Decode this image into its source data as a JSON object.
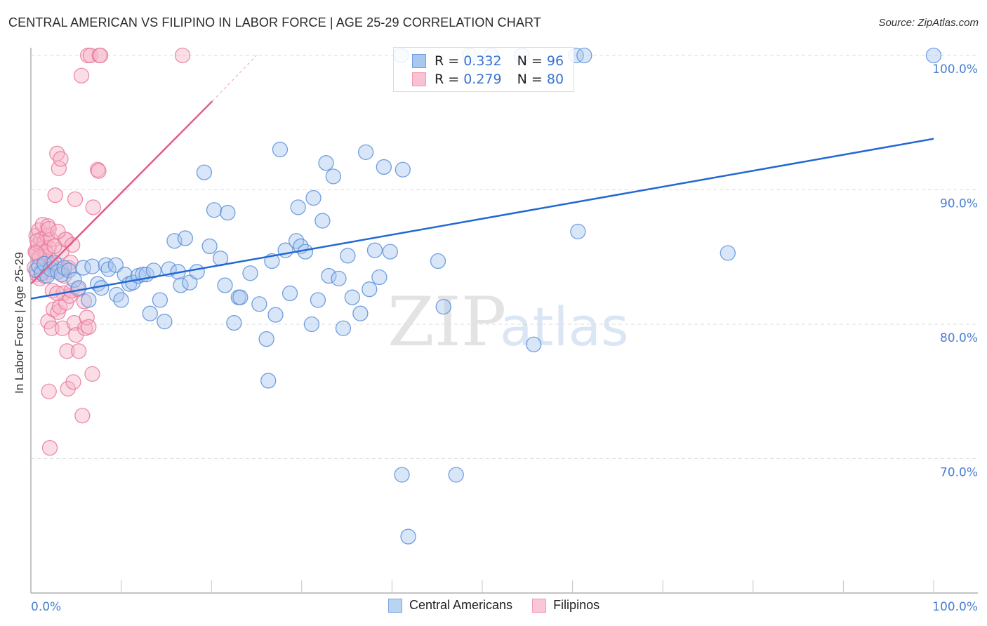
{
  "header": {
    "title": "CENTRAL AMERICAN VS FILIPINO IN LABOR FORCE | AGE 25-29 CORRELATION CHART",
    "source": "Source: ZipAtlas.com"
  },
  "watermark": {
    "zip": "ZIP",
    "atlas": "atlas"
  },
  "legend": {
    "rows": [
      {
        "r_label": "R =",
        "r_value": "0.332",
        "n_label": "N =",
        "n_value": "96"
      },
      {
        "r_label": "R =",
        "r_value": "0.279",
        "n_label": "N =",
        "n_value": "80"
      }
    ]
  },
  "colors": {
    "blue_fill": "#a9c8f0",
    "blue_stroke": "#5b8fd9",
    "blue_line": "#2268d3",
    "pink_fill": "#f7b3c8",
    "pink_stroke": "#e87a9c",
    "pink_line": "#e35d88",
    "tick_text": "#4a7fd1",
    "grid": "#dddddd"
  },
  "chart_data": {
    "type": "scatter",
    "title": "CENTRAL AMERICAN VS FILIPINO IN LABOR FORCE | AGE 25-29 CORRELATION CHART",
    "xlabel": "",
    "ylabel": "In Labor Force | Age 25-29",
    "xlim": [
      0,
      100
    ],
    "ylim": [
      62.5,
      101.2
    ],
    "x_tick_labels": [
      "0.0%",
      "100.0%"
    ],
    "y_ticks": [
      70,
      80,
      90,
      100
    ],
    "y_tick_labels": [
      "70.0%",
      "80.0%",
      "90.0%",
      "100.0%"
    ],
    "grid": "horizontal-dashed",
    "legend_position": "top-center",
    "series": [
      {
        "name": "Central Americans",
        "r": 0.332,
        "n": 96,
        "trend": {
          "x": [
            0,
            100
          ],
          "y": [
            81.9,
            93.8
          ]
        },
        "points": [
          [
            0.6,
            84.0
          ],
          [
            0.9,
            84.3
          ],
          [
            1.2,
            83.8
          ],
          [
            1.5,
            84.5
          ],
          [
            1.8,
            83.6
          ],
          [
            2.2,
            84.1
          ],
          [
            2.6,
            84.6
          ],
          [
            3.0,
            83.9
          ],
          [
            3.4,
            83.7
          ],
          [
            3.7,
            84.2
          ],
          [
            4.2,
            84.0
          ],
          [
            4.8,
            83.3
          ],
          [
            5.3,
            82.7
          ],
          [
            5.8,
            84.2
          ],
          [
            6.4,
            81.8
          ],
          [
            6.8,
            84.3
          ],
          [
            7.4,
            83.0
          ],
          [
            7.8,
            82.7
          ],
          [
            8.3,
            84.4
          ],
          [
            8.6,
            84.1
          ],
          [
            9.4,
            84.4
          ],
          [
            9.5,
            82.2
          ],
          [
            10.0,
            81.8
          ],
          [
            10.4,
            83.7
          ],
          [
            10.9,
            83.0
          ],
          [
            11.3,
            83.1
          ],
          [
            11.9,
            83.6
          ],
          [
            12.4,
            83.7
          ],
          [
            12.8,
            83.7
          ],
          [
            13.2,
            80.8
          ],
          [
            13.6,
            84.0
          ],
          [
            14.3,
            81.8
          ],
          [
            14.8,
            80.2
          ],
          [
            15.3,
            84.1
          ],
          [
            15.9,
            86.2
          ],
          [
            16.3,
            83.9
          ],
          [
            16.6,
            82.9
          ],
          [
            17.1,
            86.4
          ],
          [
            17.6,
            83.1
          ],
          [
            18.4,
            83.9
          ],
          [
            19.2,
            91.3
          ],
          [
            19.8,
            85.8
          ],
          [
            20.3,
            88.5
          ],
          [
            21.0,
            84.9
          ],
          [
            21.5,
            82.9
          ],
          [
            21.8,
            88.3
          ],
          [
            22.5,
            80.1
          ],
          [
            23.0,
            82.0
          ],
          [
            23.2,
            82.0
          ],
          [
            24.3,
            83.8
          ],
          [
            25.3,
            81.5
          ],
          [
            26.1,
            78.9
          ],
          [
            26.3,
            75.8
          ],
          [
            26.7,
            84.7
          ],
          [
            27.1,
            80.7
          ],
          [
            27.6,
            93.0
          ],
          [
            28.2,
            85.5
          ],
          [
            28.7,
            82.3
          ],
          [
            29.4,
            86.2
          ],
          [
            29.6,
            88.7
          ],
          [
            29.9,
            85.8
          ],
          [
            30.4,
            85.4
          ],
          [
            31.1,
            80.0
          ],
          [
            31.3,
            89.4
          ],
          [
            31.8,
            81.8
          ],
          [
            32.3,
            87.7
          ],
          [
            32.7,
            92.0
          ],
          [
            33.0,
            83.6
          ],
          [
            33.5,
            91.0
          ],
          [
            34.1,
            83.4
          ],
          [
            34.6,
            79.7
          ],
          [
            35.1,
            85.1
          ],
          [
            35.6,
            82.0
          ],
          [
            36.5,
            80.8
          ],
          [
            37.1,
            92.8
          ],
          [
            37.5,
            82.6
          ],
          [
            38.1,
            85.5
          ],
          [
            38.6,
            83.5
          ],
          [
            39.1,
            91.7
          ],
          [
            39.8,
            85.4
          ],
          [
            41.0,
            100.0
          ],
          [
            41.1,
            68.8
          ],
          [
            41.2,
            91.5
          ],
          [
            41.8,
            64.2
          ],
          [
            45.1,
            84.7
          ],
          [
            45.7,
            81.3
          ],
          [
            47.1,
            68.8
          ],
          [
            48.6,
            100.0
          ],
          [
            51.0,
            100.0
          ],
          [
            54.4,
            100.0
          ],
          [
            55.7,
            78.5
          ],
          [
            60.4,
            100.0
          ],
          [
            60.6,
            86.9
          ],
          [
            61.3,
            100.0
          ],
          [
            77.2,
            85.3
          ],
          [
            100.0,
            100.0
          ]
        ]
      },
      {
        "name": "Filipinos",
        "r": 0.279,
        "n": 80,
        "trend": {
          "x": [
            0,
            20.1
          ],
          "y": [
            83.0,
            96.6
          ],
          "extended": {
            "x": [
              20.1,
              25.0
            ],
            "y": [
              96.6,
              100.0
            ]
          }
        },
        "points": [
          [
            0.4,
            84.2
          ],
          [
            0.5,
            85.4
          ],
          [
            0.6,
            86.6
          ],
          [
            0.7,
            83.7
          ],
          [
            0.8,
            85.9
          ],
          [
            0.9,
            87.0
          ],
          [
            1.0,
            84.9
          ],
          [
            1.1,
            86.3
          ],
          [
            1.2,
            85.6
          ],
          [
            1.3,
            87.4
          ],
          [
            1.4,
            84.4
          ],
          [
            1.5,
            86.1
          ],
          [
            1.6,
            85.0
          ],
          [
            1.7,
            84.7
          ],
          [
            1.8,
            86.6
          ],
          [
            1.9,
            87.3
          ],
          [
            2.0,
            85.7
          ],
          [
            2.1,
            83.9
          ],
          [
            2.2,
            86.3
          ],
          [
            2.3,
            84.5
          ],
          [
            1.9,
            80.2
          ],
          [
            2.0,
            75.0
          ],
          [
            2.1,
            70.8
          ],
          [
            2.2,
            84.4
          ],
          [
            2.3,
            79.7
          ],
          [
            2.4,
            82.5
          ],
          [
            2.5,
            81.1
          ],
          [
            2.7,
            89.6
          ],
          [
            2.9,
            92.7
          ],
          [
            3.0,
            80.9
          ],
          [
            3.1,
            91.6
          ],
          [
            3.2,
            81.3
          ],
          [
            3.3,
            92.3
          ],
          [
            3.4,
            85.4
          ],
          [
            3.5,
            79.7
          ],
          [
            3.6,
            82.3
          ],
          [
            3.7,
            83.6
          ],
          [
            3.8,
            86.3
          ],
          [
            3.9,
            86.3
          ],
          [
            3.9,
            81.6
          ],
          [
            4.0,
            78.0
          ],
          [
            4.1,
            75.2
          ],
          [
            4.2,
            84.2
          ],
          [
            4.3,
            82.1
          ],
          [
            4.4,
            84.6
          ],
          [
            4.5,
            82.5
          ],
          [
            4.6,
            85.9
          ],
          [
            4.7,
            75.7
          ],
          [
            4.8,
            80.1
          ],
          [
            4.9,
            89.3
          ],
          [
            5.0,
            79.2
          ],
          [
            5.2,
            82.6
          ],
          [
            5.3,
            78.0
          ],
          [
            5.6,
            98.5
          ],
          [
            5.7,
            73.2
          ],
          [
            5.9,
            81.7
          ],
          [
            6.0,
            79.7
          ],
          [
            6.2,
            80.5
          ],
          [
            6.4,
            79.8
          ],
          [
            6.3,
            100.0
          ],
          [
            6.6,
            100.0
          ],
          [
            6.8,
            76.3
          ],
          [
            6.9,
            88.7
          ],
          [
            7.4,
            91.5
          ],
          [
            7.5,
            91.4
          ],
          [
            7.6,
            100.0
          ],
          [
            7.7,
            100.0
          ],
          [
            16.8,
            100.0
          ],
          [
            1.0,
            83.4
          ],
          [
            0.7,
            86.2
          ],
          [
            1.2,
            84.0
          ],
          [
            1.6,
            85.4
          ],
          [
            0.9,
            85.0
          ],
          [
            2.6,
            85.8
          ],
          [
            2.9,
            82.3
          ],
          [
            3.3,
            84.1
          ],
          [
            1.5,
            83.6
          ],
          [
            0.6,
            85.3
          ],
          [
            2.0,
            87.1
          ],
          [
            3.0,
            86.9
          ]
        ]
      }
    ]
  },
  "axis": {
    "ylabel": "In Labor Force | Age 25-29",
    "x_left": "0.0%",
    "x_right": "100.0%",
    "y_labels": [
      "100.0%",
      "90.0%",
      "80.0%",
      "70.0%"
    ]
  },
  "bottom_legend": {
    "items": [
      "Central Americans",
      "Filipinos"
    ]
  }
}
